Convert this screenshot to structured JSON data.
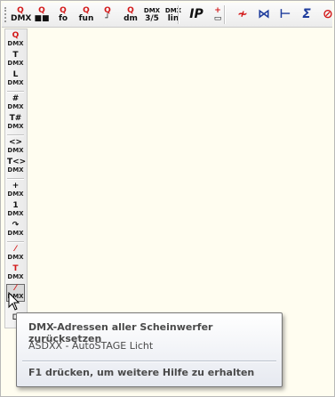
{
  "toolbar": {
    "buttons": [
      {
        "top": "Q",
        "bottom": "DMX",
        "icon": "query-dmx-icon"
      },
      {
        "top": "Q",
        "bottom": "■■",
        "icon": "query-color-icon"
      },
      {
        "top": "Q",
        "bottom": "fo",
        "icon": "query-focus-icon"
      },
      {
        "top": "Q",
        "bottom": "fun",
        "icon": "query-function-icon"
      },
      {
        "top": "Q",
        "bottom": "┘",
        "icon": "query-position-icon"
      },
      {
        "top": "Q",
        "bottom": "dm",
        "icon": "query-dimmer-icon"
      },
      {
        "top": "DMX",
        "bottom": "3/5",
        "icon": "dmx-3-5-icon"
      },
      {
        "top": "DMX",
        "bottom": "lin",
        "icon": "dmx-linear-icon"
      },
      {
        "top": "IP",
        "bottom": "",
        "icon": "ip-icon"
      },
      {
        "top": "+",
        "bottom": "▭",
        "icon": "add-unit-icon"
      },
      {
        "top": "≁",
        "bottom": "",
        "icon": "remove-link-icon"
      },
      {
        "top": "⋈",
        "bottom": "",
        "icon": "split-icon"
      },
      {
        "top": "⊢",
        "bottom": "",
        "icon": "align-icon"
      },
      {
        "top": "Σ",
        "bottom": "",
        "icon": "sum-icon"
      },
      {
        "top": "⊘",
        "bottom": "",
        "icon": "clear-icon"
      }
    ]
  },
  "vtoolbar": {
    "groups": [
      [
        {
          "sym": "Q",
          "label": "DMX",
          "red": true,
          "icon": "query-dmx-icon"
        },
        {
          "sym": "T",
          "label": "DMX",
          "red": false,
          "icon": "dmx-t-icon"
        },
        {
          "sym": "L",
          "label": "DMX",
          "red": false,
          "icon": "dmx-l-icon"
        }
      ],
      [
        {
          "sym": "#",
          "label": "DMX",
          "red": false,
          "icon": "dmx-number-icon"
        },
        {
          "sym": "T#",
          "label": "DMX",
          "red": false,
          "icon": "dmx-t-number-icon"
        }
      ],
      [
        {
          "sym": "<>",
          "label": "DMX",
          "red": false,
          "icon": "dmx-swap-icon"
        },
        {
          "sym": "T<>",
          "label": "DMX",
          "red": false,
          "icon": "dmx-t-swap-icon"
        }
      ],
      [
        {
          "sym": "+",
          "label": "DMX",
          "red": false,
          "icon": "dmx-add-icon"
        },
        {
          "sym": "1",
          "label": "DMX",
          "red": false,
          "icon": "dmx-one-icon"
        },
        {
          "sym": "↷",
          "label": "DMX",
          "red": false,
          "icon": "dmx-rotate-icon"
        }
      ],
      [
        {
          "sym": "⁄",
          "label": "DMX",
          "red": true,
          "icon": "dmx-strike-icon"
        },
        {
          "sym": "T",
          "label": "DMX",
          "red": true,
          "icon": "dmx-t-strike-icon"
        },
        {
          "sym": "⁄",
          "label": "DMX",
          "red": true,
          "icon": "dmx-reset-all-icon",
          "pressed": true
        }
      ]
    ],
    "bottom_icon": "⊏"
  },
  "tooltip": {
    "title": "DMX-Adressen aller Scheinwerfer zurücksetzen",
    "subtitle": "ASDXX - AutoSTAGE Licht",
    "help": "F1 drücken, um weitere Hilfe zu erhalten"
  }
}
